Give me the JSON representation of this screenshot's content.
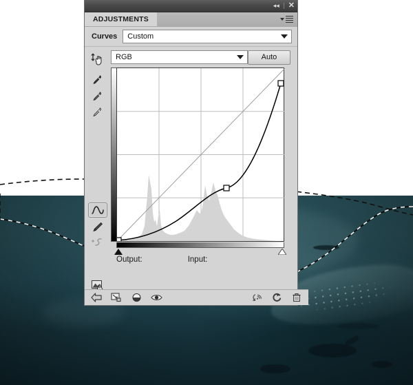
{
  "window": {
    "titlebar": {
      "collapse_icon": "double-chevron-left-icon",
      "close_icon": "close-icon"
    }
  },
  "panel": {
    "tab_label": "ADJUSTMENTS",
    "menu_icon": "panel-menu-icon",
    "preset_row": {
      "label": "Curves",
      "preset_value": "Custom",
      "dropdown_icon": "chevron-down-icon"
    },
    "channel_row": {
      "channel_value": "RGB",
      "dropdown_icon": "chevron-down-icon",
      "auto_label": "Auto"
    },
    "tools": [
      {
        "name": "on-image-adjust-tool",
        "icon": "hand-arrows-icon",
        "selected": false
      },
      {
        "name": "black-point-eyedropper",
        "icon": "eyedropper-icon",
        "selected": false
      },
      {
        "name": "gray-point-eyedropper",
        "icon": "eyedropper-icon",
        "selected": false
      },
      {
        "name": "white-point-eyedropper",
        "icon": "eyedropper-icon",
        "selected": false
      },
      {
        "name": "edit-points-curve-tool",
        "icon": "curve-icon",
        "selected": true
      },
      {
        "name": "pencil-draw-curve-tool",
        "icon": "pencil-icon",
        "selected": false
      },
      {
        "name": "smooth-curve-tool",
        "icon": "smooth-curve-icon",
        "selected": false
      },
      {
        "name": "clipping-warning-icon",
        "icon": "clipping-warning-icon",
        "selected": false
      }
    ],
    "readout": {
      "output_label": "Output:",
      "output_value": "",
      "input_label": "Input:",
      "input_value": ""
    },
    "footer_buttons": [
      {
        "name": "return-to-adjustment-list-button",
        "icon": "left-arrow-icon"
      },
      {
        "name": "clip-to-layer-button",
        "icon": "clip-layer-icon"
      },
      {
        "name": "toggle-layer-mask-button",
        "icon": "mask-toggle-icon"
      },
      {
        "name": "toggle-layer-visibility-button",
        "icon": "eye-icon"
      },
      {
        "name": "preview-previous-state-button",
        "icon": "preview-previous-icon"
      },
      {
        "name": "reset-adjustment-button",
        "icon": "reset-circle-icon"
      },
      {
        "name": "delete-adjustment-layer-button",
        "icon": "trash-icon"
      }
    ],
    "colors": {
      "panel_bg": "#d4d4d4",
      "titlebar_bg": "#4a4a4a",
      "graph_bg": "#ffffff",
      "grid_line": "#b7b7b7",
      "curve_stroke": "#000000",
      "histogram_fill": "#d2d2d2"
    }
  },
  "chart_data": {
    "type": "line",
    "title": "Curves (RGB)",
    "xlabel": "Input",
    "ylabel": "Output",
    "xlim": [
      0,
      255
    ],
    "ylim": [
      0,
      255
    ],
    "grid": true,
    "grid_divisions": 4,
    "legend": "none",
    "series": [
      {
        "name": "baseline-diagonal",
        "style": "thin-gray-diagonal",
        "x": [
          0,
          255
        ],
        "values": [
          0,
          255
        ]
      },
      {
        "name": "rgb-curve",
        "style": "black-curve",
        "control_points": [
          {
            "input": 0,
            "output": 0
          },
          {
            "input": 166,
            "output": 78
          },
          {
            "input": 252,
            "output": 239
          }
        ],
        "x": [
          0,
          16,
          32,
          48,
          64,
          80,
          96,
          112,
          128,
          144,
          160,
          176,
          192,
          208,
          224,
          240,
          252
        ],
        "values": [
          0,
          2,
          5,
          9,
          14,
          20,
          27,
          36,
          45,
          55,
          72,
          88,
          110,
          137,
          168,
          205,
          239
        ]
      },
      {
        "name": "histogram",
        "style": "gray-area",
        "x": [
          0,
          10,
          20,
          30,
          38,
          42,
          46,
          50,
          54,
          58,
          62,
          66,
          70,
          74,
          78,
          82,
          86,
          92,
          98,
          104,
          110,
          116,
          122,
          128,
          134,
          140,
          146,
          152,
          158,
          164,
          170,
          176,
          182,
          190,
          200,
          210,
          220,
          230,
          240,
          255
        ],
        "values": [
          0,
          1,
          2,
          4,
          10,
          22,
          66,
          86,
          30,
          18,
          44,
          16,
          9,
          7,
          6,
          6,
          7,
          9,
          12,
          22,
          38,
          55,
          52,
          78,
          58,
          74,
          60,
          40,
          30,
          24,
          18,
          12,
          8,
          5,
          3,
          2,
          1,
          1,
          0,
          0
        ]
      }
    ],
    "black_point_slider": 0,
    "white_point_slider": 255
  }
}
